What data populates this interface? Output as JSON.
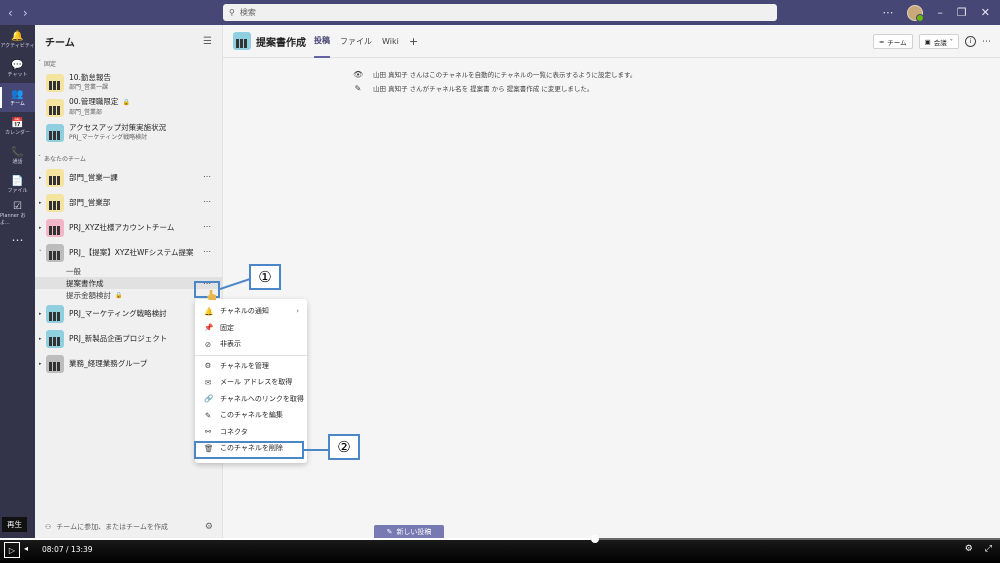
{
  "titlebar": {
    "search_placeholder": "検索",
    "icons": [
      "back-icon",
      "forward-icon",
      "more-icon",
      "minimize-icon",
      "maximize-icon",
      "close-icon"
    ]
  },
  "rail": {
    "items": [
      {
        "label": "アクティビティ",
        "icon": "bell-icon",
        "glyph": "🔔"
      },
      {
        "label": "チャット",
        "icon": "chat-icon",
        "glyph": "💬"
      },
      {
        "label": "チーム",
        "icon": "teams-icon",
        "glyph": "👥",
        "active": true
      },
      {
        "label": "カレンダー",
        "icon": "calendar-icon",
        "glyph": "📅"
      },
      {
        "label": "通話",
        "icon": "phone-icon",
        "glyph": "📞"
      },
      {
        "label": "ファイル",
        "icon": "file-icon",
        "glyph": "📄"
      },
      {
        "label": "Planner およ...",
        "icon": "planner-icon",
        "glyph": "☑"
      }
    ],
    "more": "…"
  },
  "teams_panel": {
    "title": "チーム",
    "pinned_label": "固定",
    "pinned": [
      {
        "name": "10.勤怠報告",
        "sub": "部門_営業一課",
        "color": "yellow"
      },
      {
        "name": "00.管理職限定",
        "sub": "部門_営業部",
        "color": "yellow",
        "locked": true
      },
      {
        "name": "アクセスアップ対策実施状況",
        "sub": "PRJ_マーケティング戦略検討",
        "color": "teal"
      }
    ],
    "your_teams_label": "あなたのチーム",
    "teams_top": [
      {
        "name": "部門_営業一課",
        "color": "yellow"
      },
      {
        "name": "部門_営業部",
        "color": "yellow"
      },
      {
        "name": "PRJ_XYZ社様アカウントチーム",
        "color": "pink"
      },
      {
        "name": "PRJ_【提案】XYZ社WFシステム提案",
        "color": "gray",
        "expanded": true
      }
    ],
    "channels": [
      {
        "name": "一般"
      },
      {
        "name": "提案書作成",
        "selected": true
      },
      {
        "name": "提示金額検討",
        "locked": true
      }
    ],
    "teams_bottom": [
      {
        "name": "PRJ_マーケティング戦略検討",
        "color": "teal"
      },
      {
        "name": "PRJ_新製品企画プロジェクト",
        "color": "teal"
      },
      {
        "name": "業務_経理業務グループ",
        "color": "gray"
      }
    ],
    "footer": "チームに参加、またはチームを作成"
  },
  "channel": {
    "title": "提案書作成",
    "tabs": [
      "投稿",
      "ファイル",
      "Wiki"
    ],
    "add": "+",
    "team_btn": "チーム",
    "meet_btn": "会議",
    "messages": [
      {
        "icon": "eye-icon",
        "glyph": "👁",
        "text": "山田 真知子 さんはこのチャネルを自動的にチャネルの一覧に表示するように設定します。"
      },
      {
        "icon": "edit-icon",
        "glyph": "✎",
        "text": "山田 真知子 さんがチャネル名を 提案書 から 提案書作成 に変更しました。"
      }
    ],
    "new_post": "新しい投稿"
  },
  "context_menu": {
    "group1": [
      {
        "label": "チャネルの通知",
        "icon": "bell-icon",
        "glyph": "🔔",
        "submenu": true
      },
      {
        "label": "固定",
        "icon": "pin-icon",
        "glyph": "📌"
      },
      {
        "label": "非表示",
        "icon": "hide-icon",
        "glyph": "⊘"
      }
    ],
    "group2": [
      {
        "label": "チャネルを管理",
        "icon": "gear-icon",
        "glyph": "⚙"
      },
      {
        "label": "メール アドレスを取得",
        "icon": "mail-icon",
        "glyph": "✉"
      },
      {
        "label": "チャネルへのリンクを取得",
        "icon": "link-icon",
        "glyph": "🔗"
      },
      {
        "label": "このチャネルを編集",
        "icon": "pencil-icon",
        "glyph": "✎"
      },
      {
        "label": "コネクタ",
        "icon": "connector-icon",
        "glyph": "⚯"
      },
      {
        "label": "このチャネルを削除",
        "icon": "trash-icon",
        "glyph": "🗑"
      }
    ]
  },
  "annotations": {
    "step1": "①",
    "step2": "②",
    "color": "#4a86c8"
  },
  "video": {
    "current": "08:07",
    "separator": "/",
    "total": "13:39",
    "progress": 0.595,
    "play_tooltip": "再生"
  },
  "colors": {
    "titlebar": "#464775",
    "rail": "#33344a",
    "accent": "#6264a7"
  }
}
